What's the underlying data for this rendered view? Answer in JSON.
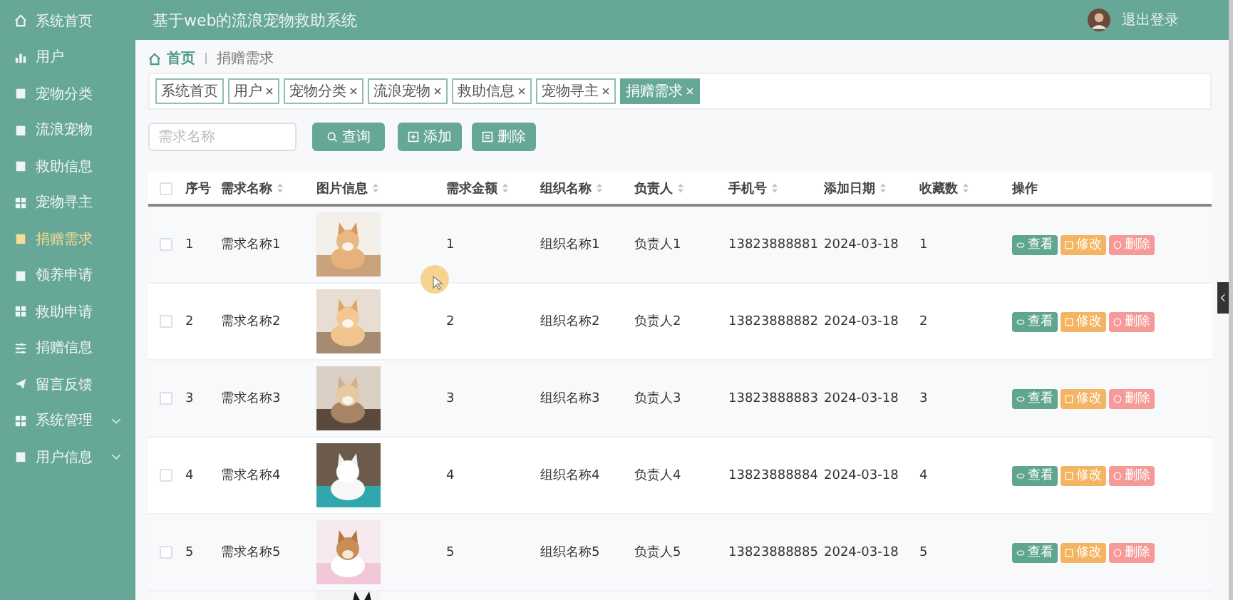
{
  "header": {
    "title": "基于web的流浪宠物救助系统",
    "logout": "退出登录"
  },
  "sidebar": {
    "items": [
      {
        "label": "系统首页",
        "selected": false,
        "submenu": false
      },
      {
        "label": "用户",
        "selected": false,
        "submenu": false
      },
      {
        "label": "宠物分类",
        "selected": false,
        "submenu": false
      },
      {
        "label": "流浪宠物",
        "selected": false,
        "submenu": false
      },
      {
        "label": "救助信息",
        "selected": false,
        "submenu": false
      },
      {
        "label": "宠物寻主",
        "selected": false,
        "submenu": false
      },
      {
        "label": "捐赠需求",
        "selected": true,
        "submenu": false
      },
      {
        "label": "领养申请",
        "selected": false,
        "submenu": false
      },
      {
        "label": "救助申请",
        "selected": false,
        "submenu": false
      },
      {
        "label": "捐赠信息",
        "selected": false,
        "submenu": false
      },
      {
        "label": "留言反馈",
        "selected": false,
        "submenu": false
      },
      {
        "label": "系统管理",
        "selected": false,
        "submenu": true
      },
      {
        "label": "用户信息",
        "selected": false,
        "submenu": true
      }
    ]
  },
  "breadcrumb": [
    "首页",
    "捐赠需求"
  ],
  "tags": [
    {
      "label": "系统首页",
      "closable": false,
      "selected": false
    },
    {
      "label": "用户",
      "closable": true,
      "selected": false
    },
    {
      "label": "宠物分类",
      "closable": true,
      "selected": false
    },
    {
      "label": "流浪宠物",
      "closable": true,
      "selected": false
    },
    {
      "label": "救助信息",
      "closable": true,
      "selected": false
    },
    {
      "label": "宠物寻主",
      "closable": true,
      "selected": false
    },
    {
      "label": "捐赠需求",
      "closable": true,
      "selected": true
    }
  ],
  "search": {
    "placeholder": "需求名称",
    "buttons": [
      {
        "kind": "search",
        "label": "查询"
      },
      {
        "kind": "add",
        "label": "添加"
      },
      {
        "kind": "delete",
        "label": "删除"
      }
    ]
  },
  "table": {
    "columns": [
      {
        "label": "序号",
        "sortable": false
      },
      {
        "label": "需求名称",
        "sortable": true
      },
      {
        "label": "图片信息",
        "sortable": true
      },
      {
        "label": "需求金额",
        "sortable": true
      },
      {
        "label": "组织名称",
        "sortable": true
      },
      {
        "label": "负责人",
        "sortable": true
      },
      {
        "label": "手机号",
        "sortable": true
      },
      {
        "label": "添加日期",
        "sortable": true
      },
      {
        "label": "收藏数",
        "sortable": true
      },
      {
        "label": "操作",
        "sortable": false
      }
    ],
    "header_checked": false,
    "rows": [
      {
        "checked": false,
        "cells": [
          "1",
          "需求名称1",
          "",
          "1",
          "组织名称1",
          "负责人1",
          "13823888881",
          "2024-03-18",
          "1"
        ],
        "actions": [
          {
            "kind": "view",
            "label": "查看"
          },
          {
            "kind": "edit",
            "label": "修改"
          },
          {
            "kind": "delete",
            "label": "删除"
          }
        ]
      },
      {
        "checked": false,
        "cells": [
          "2",
          "需求名称2",
          "",
          "2",
          "组织名称2",
          "负责人2",
          "13823888882",
          "2024-03-18",
          "2"
        ],
        "actions": [
          {
            "kind": "view",
            "label": "查看"
          },
          {
            "kind": "edit",
            "label": "修改"
          },
          {
            "kind": "delete",
            "label": "删除"
          }
        ]
      },
      {
        "checked": false,
        "cells": [
          "3",
          "需求名称3",
          "",
          "3",
          "组织名称3",
          "负责人3",
          "13823888883",
          "2024-03-18",
          "3"
        ],
        "actions": [
          {
            "kind": "view",
            "label": "查看"
          },
          {
            "kind": "edit",
            "label": "修改"
          },
          {
            "kind": "delete",
            "label": "删除"
          }
        ]
      },
      {
        "checked": false,
        "cells": [
          "4",
          "需求名称4",
          "",
          "4",
          "组织名称4",
          "负责人4",
          "13823888884",
          "2024-03-18",
          "4"
        ],
        "actions": [
          {
            "kind": "view",
            "label": "查看"
          },
          {
            "kind": "edit",
            "label": "修改"
          },
          {
            "kind": "delete",
            "label": "删除"
          }
        ]
      },
      {
        "checked": false,
        "cells": [
          "5",
          "需求名称5",
          "",
          "5",
          "组织名称5",
          "负责人5",
          "13823888885",
          "2024-03-18",
          "5"
        ],
        "actions": [
          {
            "kind": "view",
            "label": "查看"
          },
          {
            "kind": "edit",
            "label": "修改"
          },
          {
            "kind": "delete",
            "label": "删除"
          }
        ]
      }
    ]
  }
}
